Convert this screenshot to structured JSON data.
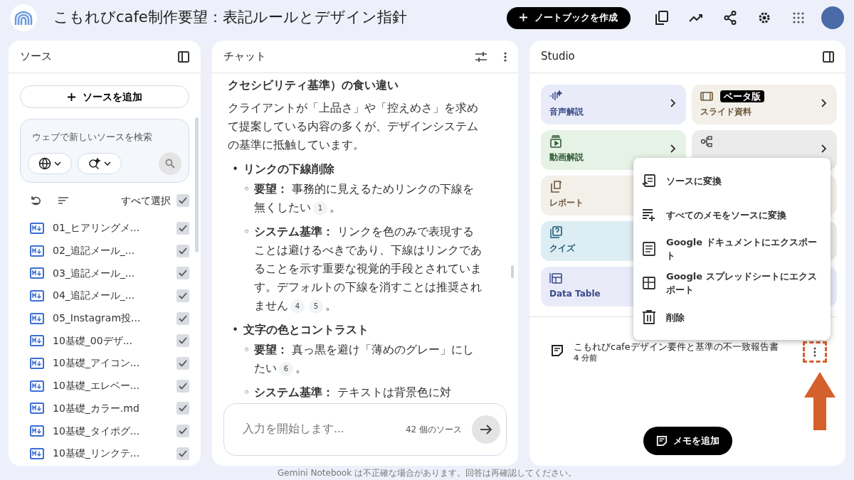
{
  "header": {
    "title": "こもれびcafe制作要望：表記ルールとデザイン指針",
    "create_button": "ノートブックを作成"
  },
  "sources": {
    "title": "ソース",
    "add_button": "ソースを追加",
    "search": {
      "placeholder": "ウェブで新しいソースを検索"
    },
    "select_all": {
      "label": "すべて選択",
      "checked": true
    },
    "items": [
      {
        "name": "01_ヒアリングメ...",
        "checked": true
      },
      {
        "name": "02_追記メール_...",
        "checked": true
      },
      {
        "name": "03_追記メール_...",
        "checked": true
      },
      {
        "name": "04_追記メール_...",
        "checked": true
      },
      {
        "name": "05_Instagram投...",
        "checked": true
      },
      {
        "name": "10基礎_00デザ...",
        "checked": true
      },
      {
        "name": "10基礎_アイコン...",
        "checked": true
      },
      {
        "name": "10基礎_エレベー...",
        "checked": true
      },
      {
        "name": "10基礎_カラー.md",
        "checked": true
      },
      {
        "name": "10基礎_タイポグ...",
        "checked": true
      },
      {
        "name": "10基礎_リンクテ...",
        "checked": true
      }
    ]
  },
  "chat": {
    "title": "チャット",
    "blocks": [
      {
        "kind": "heading",
        "text": "クセシビリティ基準）の食い違い"
      },
      {
        "kind": "paragraph",
        "text": "クライアントが「上品さ」や「控えめさ」を求めて提案している内容の多くが、デザインシステムの基準に抵触しています。"
      },
      {
        "kind": "bullet",
        "marker": "•",
        "text": "リンクの下線削除",
        "children": [
          {
            "marker": "◦",
            "label": "要望：",
            "text": "事務的に見えるためリンクの下線を無くしたい",
            "citations": [
              "1"
            ],
            "end": "。"
          },
          {
            "marker": "◦",
            "label": "システム基準：",
            "text": "リンクを色のみで表現することは避けるべきであり、下線はリンクであることを示す重要な視覚的手段とされています。デフォルトの下線を消すことは推奨されません",
            "citations": [
              "4",
              "5"
            ],
            "end": "。"
          }
        ]
      },
      {
        "kind": "bullet",
        "marker": "•",
        "text": "文字の色とコントラスト",
        "children": [
          {
            "marker": "◦",
            "label": "要望：",
            "text": "真っ黒を避け「薄めのグレー」にしたい",
            "citations": [
              "6"
            ],
            "end": "。"
          },
          {
            "marker": "◦",
            "label": "システム基準：",
            "text": "テキストは背景色に対"
          }
        ]
      }
    ],
    "input": {
      "placeholder": "入力を開始します...",
      "source_count": "42 個のソース"
    }
  },
  "studio": {
    "title": "Studio",
    "tiles": [
      {
        "kind": "audio",
        "label": "音声解説",
        "color": "#e9ecf8",
        "chevron": true
      },
      {
        "kind": "slides",
        "label": "スライド資料",
        "badge": "ベータ版",
        "color": "#f3efe9",
        "chevron": true
      },
      {
        "kind": "video",
        "label": "動画解説",
        "color": "#e6f2e6",
        "chevron": true
      },
      {
        "kind": "mindmap",
        "color": "#ebebeb",
        "chevron": true
      },
      {
        "kind": "report",
        "label": "レポート",
        "color": "#f3efe9"
      },
      {
        "kind": "hidden",
        "color": "#f3efe9"
      },
      {
        "kind": "quiz",
        "label": "クイズ",
        "color": "#dcedf3"
      },
      {
        "kind": "hidden",
        "color": "#ebebeb"
      },
      {
        "kind": "table",
        "label": "Data Table",
        "color": "#e9ecf8"
      },
      {
        "kind": "hidden",
        "color": "#e9ecf8"
      }
    ],
    "note": {
      "title": "こもれびcafeデザイン要件と基準の不一致報告書",
      "time": "4 分前",
      "highlighted": true
    },
    "add_note_button": "メモを追加",
    "menu": [
      {
        "kind": "convert",
        "label": "ソースに変換"
      },
      {
        "kind": "convert_all",
        "label": "すべてのメモをソースに変換"
      },
      {
        "kind": "doc",
        "label": "Google ドキュメントにエクスポート"
      },
      {
        "kind": "sheet",
        "label": "Google スプレッドシートにエクスポート"
      },
      {
        "kind": "delete",
        "label": "削除"
      }
    ]
  },
  "footer": "Gemini Notebook は不正確な場合があります。回答は再確認してください。"
}
